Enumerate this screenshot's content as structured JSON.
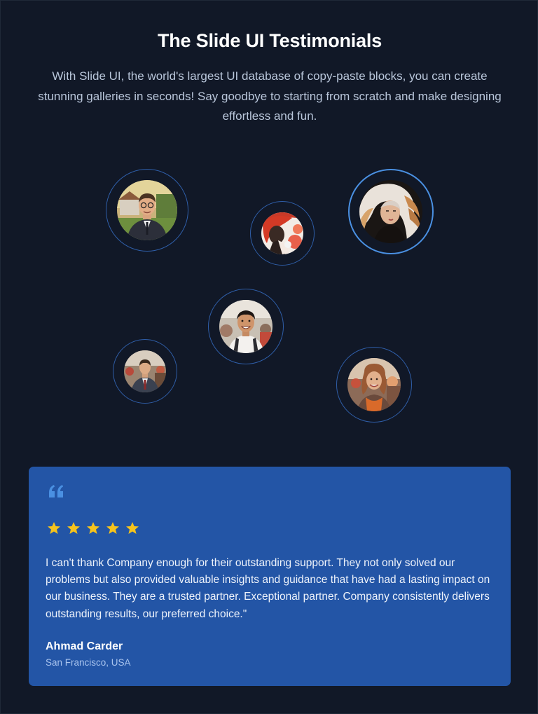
{
  "header": {
    "title": "The Slide UI Testimonials",
    "description": "With Slide UI, the world's largest UI database of copy-paste blocks, you can create stunning galleries in seconds! Say goodbye to starting from scratch and make designing effortless and fun."
  },
  "avatars": [
    {
      "name": "avatar-man-suit-glasses",
      "active": false
    },
    {
      "name": "avatar-woman-red-scarf",
      "active": false
    },
    {
      "name": "avatar-woman-white-hair",
      "active": true
    },
    {
      "name": "avatar-man-smiling-market",
      "active": false
    },
    {
      "name": "avatar-man-suit-street",
      "active": false
    },
    {
      "name": "avatar-woman-orange-scarf",
      "active": false
    }
  ],
  "testimonial": {
    "quote_icon": "quote-icon",
    "rating": 5,
    "rating_max": 5,
    "text": "I can't thank Company enough for their outstanding support. They not only solved our problems but also provided valuable insights and guidance that have had a lasting impact on our business. They are a trusted partner. Exceptional partner. Company consistently delivers outstanding results, our preferred choice.\"",
    "author": "Ahmad Carder",
    "location": "San Francisco, USA"
  },
  "colors": {
    "background": "#111827",
    "card": "#2355a6",
    "accent": "#4a90e2",
    "star": "#f6c31c",
    "ring": "#2f5ea8"
  }
}
